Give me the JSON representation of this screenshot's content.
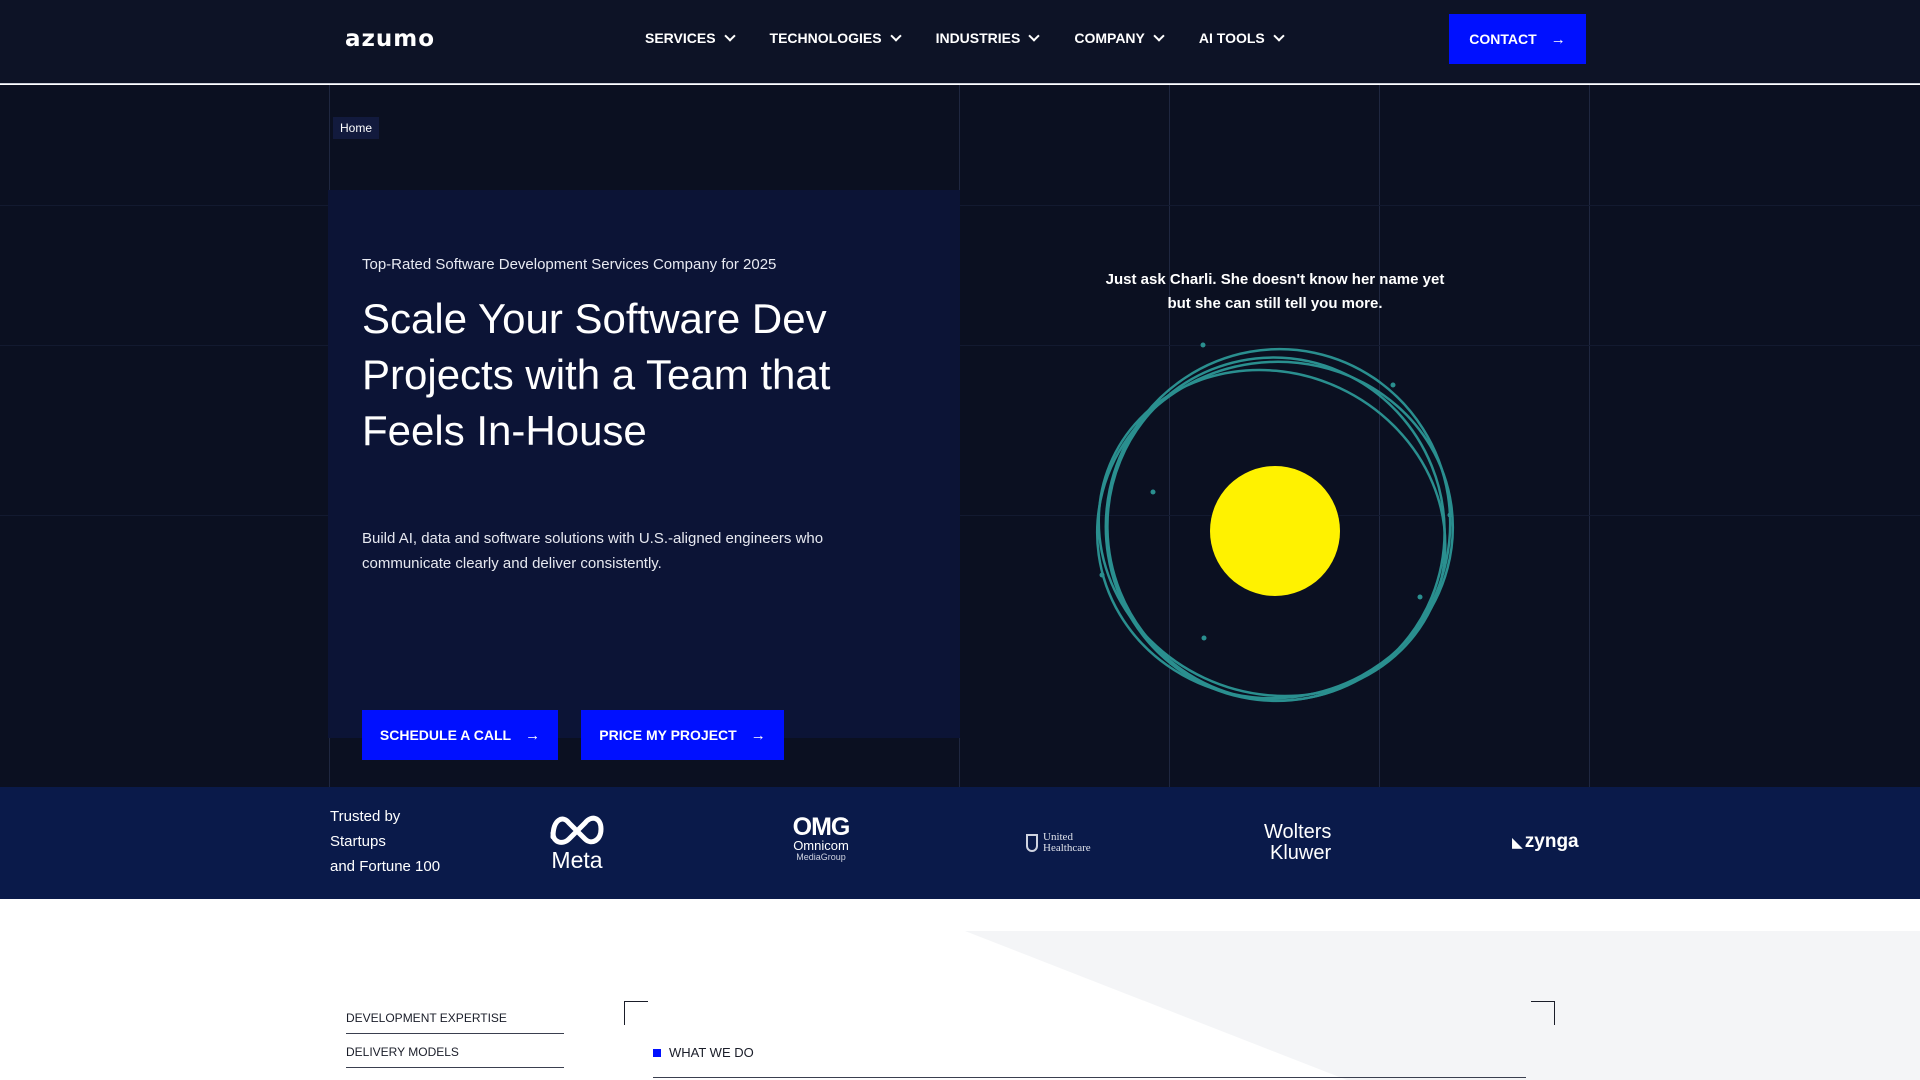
{
  "nav": {
    "logo": "azumo",
    "items": [
      {
        "label": "SERVICES"
      },
      {
        "label": "TECHNOLOGIES"
      },
      {
        "label": "INDUSTRIES"
      },
      {
        "label": "COMPANY"
      },
      {
        "label": "AI TOOLS"
      }
    ],
    "contact_label": "CONTACT"
  },
  "hero": {
    "breadcrumb": "Home",
    "eyebrow": "Top-Rated Software Development Services Company for 2025",
    "headline": "Scale Your Software Dev Projects with a Team that Feels In-House",
    "subtext": "Build AI, data and software solutions with U.S.-aligned engineers who communicate clearly and deliver consistently.",
    "cta_primary": "SCHEDULE A CALL",
    "cta_secondary": "PRICE MY PROJECT",
    "charli_prompt": "Just ask Charli. She doesn't know her name yet but she can still tell you more."
  },
  "trusted": {
    "line1": "Trusted by",
    "line2": "Startups",
    "line3": "and  Fortune 100",
    "logos": [
      {
        "name": "Meta"
      },
      {
        "name": "OMG",
        "sub1": "Omnicom",
        "sub2": "MediaGroup"
      },
      {
        "name": "United",
        "sub1": "Healthcare"
      },
      {
        "name": "Wolters",
        "sub1": "Kluwer"
      },
      {
        "name": "zynga"
      }
    ]
  },
  "lower": {
    "tabs": [
      {
        "label": "DEVELOPMENT EXPERTISE"
      },
      {
        "label": "DELIVERY MODELS"
      }
    ],
    "section_label": "WHAT WE DO"
  },
  "colors": {
    "nav_bg": "#0d1326",
    "hero_bg": "#0b1021",
    "accent_blue": "#0010ff",
    "trusted_bg": "#0a1a4a",
    "orb_yellow": "#fff200",
    "ring_teal": "#2a8f8f"
  },
  "icons": {
    "chevron": "chevron-down-icon",
    "arrow": "arrow-right-icon"
  }
}
